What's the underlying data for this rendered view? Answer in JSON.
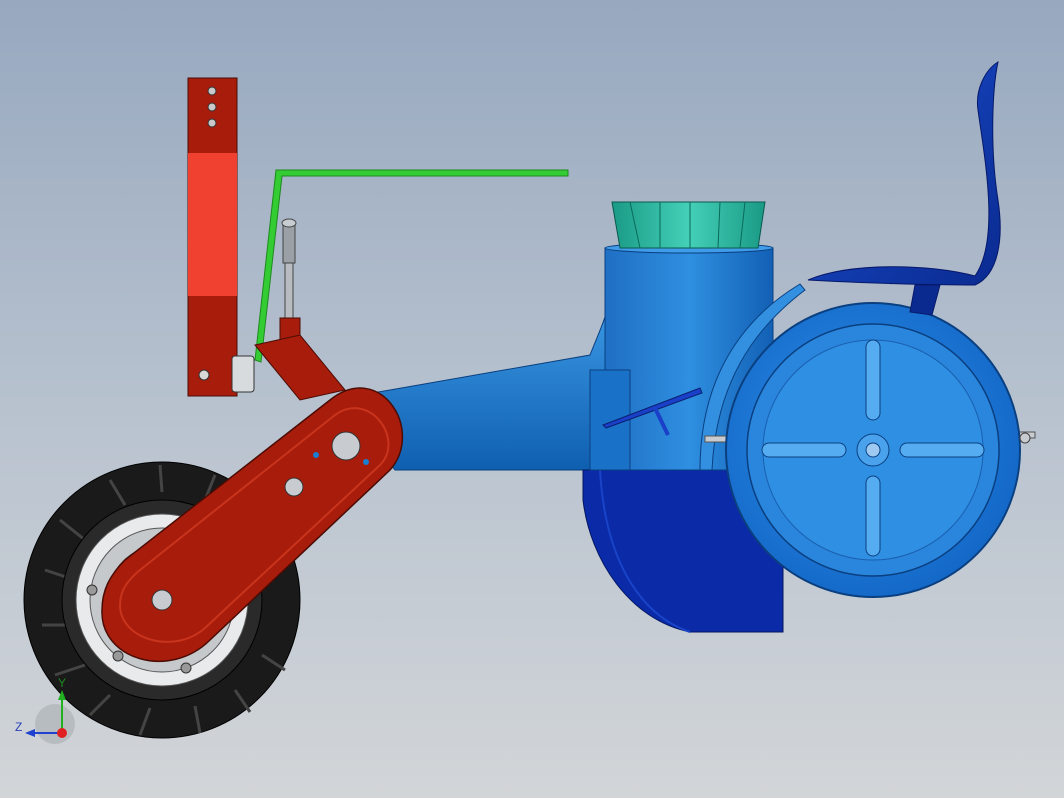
{
  "viewport": {
    "background_top": "#97a8bf",
    "background_bottom": "#d2d5d8"
  },
  "triad": {
    "y_label": "Y",
    "z_label": "Z",
    "x_color": "#e02020",
    "y_color": "#20b020",
    "z_color": "#2040d0"
  },
  "colors": {
    "frame_red": "#a81c0c",
    "frame_red_light": "#f04030",
    "hitch_green": "#33cc33",
    "body_blue": "#1a7fd0",
    "hopper_teal": "#2ab8a0",
    "furrow_navy": "#0a2aa8",
    "wheel_black": "#1a1a1a"
  }
}
